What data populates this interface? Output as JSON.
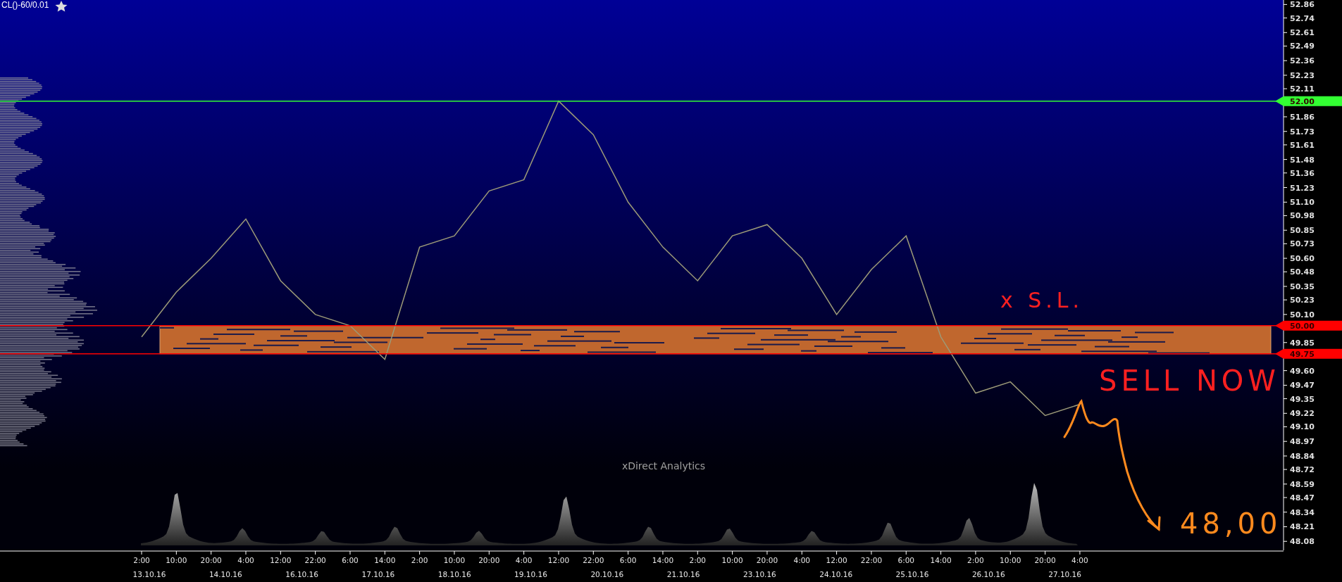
{
  "title": "CL()-60/0.01",
  "watermark": "xDirect Analytics",
  "chart_data": {
    "type": "line",
    "categories": [
      "2:00",
      "10:00",
      "20:00",
      "4:00",
      "12:00",
      "22:00",
      "6:00",
      "14:00",
      "2:00",
      "10:00",
      "20:00",
      "4:00",
      "12:00",
      "22:00",
      "6:00",
      "14:00",
      "2:00",
      "10:00",
      "20:00",
      "4:00",
      "12:00",
      "22:00",
      "6:00",
      "14:00",
      "2:00",
      "10:00",
      "20:00",
      "4:00"
    ],
    "series": [
      {
        "color": "#9c9a78",
        "values": [
          49.9,
          50.3,
          50.6,
          50.95,
          50.4,
          50.1,
          50.0,
          49.7,
          50.7,
          50.8,
          51.2,
          51.3,
          52.0,
          51.7,
          51.1,
          50.7,
          50.4,
          50.8,
          50.9,
          50.6,
          50.1,
          50.5,
          50.8,
          49.9,
          49.4,
          49.5,
          49.2,
          49.3
        ]
      }
    ],
    "ylim": [
      48.0,
      52.9
    ],
    "yticks": [
      {
        "value": 52.86,
        "label": "52.86"
      },
      {
        "value": 52.74,
        "label": "52.74"
      },
      {
        "value": 52.61,
        "label": "52.61"
      },
      {
        "value": 52.49,
        "label": "52.49"
      },
      {
        "value": 52.36,
        "label": "52.36"
      },
      {
        "value": 52.23,
        "label": "52.23"
      },
      {
        "value": 52.11,
        "label": "52.11"
      },
      {
        "value": 51.86,
        "label": "51.86"
      },
      {
        "value": 51.73,
        "label": "51.73"
      },
      {
        "value": 51.61,
        "label": "51.61"
      },
      {
        "value": 51.48,
        "label": "51.48"
      },
      {
        "value": 51.36,
        "label": "51.36"
      },
      {
        "value": 51.23,
        "label": "51.23"
      },
      {
        "value": 51.1,
        "label": "51.10"
      },
      {
        "value": 50.98,
        "label": "50.98"
      },
      {
        "value": 50.85,
        "label": "50.85"
      },
      {
        "value": 50.73,
        "label": "50.73"
      },
      {
        "value": 50.6,
        "label": "50.60"
      },
      {
        "value": 50.48,
        "label": "50.48"
      },
      {
        "value": 50.35,
        "label": "50.35"
      },
      {
        "value": 50.23,
        "label": "50.23"
      },
      {
        "value": 50.1,
        "label": "50.10"
      },
      {
        "value": 49.85,
        "label": "49.85"
      },
      {
        "value": 49.6,
        "label": "49.60"
      },
      {
        "value": 49.47,
        "label": "49.47"
      },
      {
        "value": 49.35,
        "label": "49.35"
      },
      {
        "value": 49.22,
        "label": "49.22"
      },
      {
        "value": 49.1,
        "label": "49.10"
      },
      {
        "value": 48.97,
        "label": "48.97"
      },
      {
        "value": 48.84,
        "label": "48.84"
      },
      {
        "value": 48.72,
        "label": "48.72"
      },
      {
        "value": 48.59,
        "label": "48.59"
      },
      {
        "value": 48.47,
        "label": "48.47"
      },
      {
        "value": 48.34,
        "label": "48.34"
      },
      {
        "value": 48.21,
        "label": "48.21"
      },
      {
        "value": 48.08,
        "label": "48.08"
      }
    ],
    "ref_lines": [
      {
        "axis": "y",
        "value": 52.0,
        "label": "52.00",
        "color": "#33ff33"
      },
      {
        "axis": "y",
        "value": 50.0,
        "label": "50.00",
        "color": "#ff0000"
      },
      {
        "axis": "y",
        "value": 49.75,
        "label": "49.75",
        "color": "#ff0000"
      }
    ]
  },
  "date_labels": [
    "13.10.16",
    "14.10.16",
    "16.10.16",
    "17.10.16",
    "18.10.16",
    "19.10.16",
    "20.10.16",
    "21.10.16",
    "23.10.16",
    "24.10.16",
    "25.10.16",
    "26.10.16",
    "27.10.16"
  ],
  "handwritten_notes": [
    {
      "text": "x S.L.",
      "color": "#ff2020"
    },
    {
      "text": "SELL NOW",
      "color": "#ff2020"
    },
    {
      "text": "48,00",
      "color": "#ff8a1e"
    }
  ]
}
